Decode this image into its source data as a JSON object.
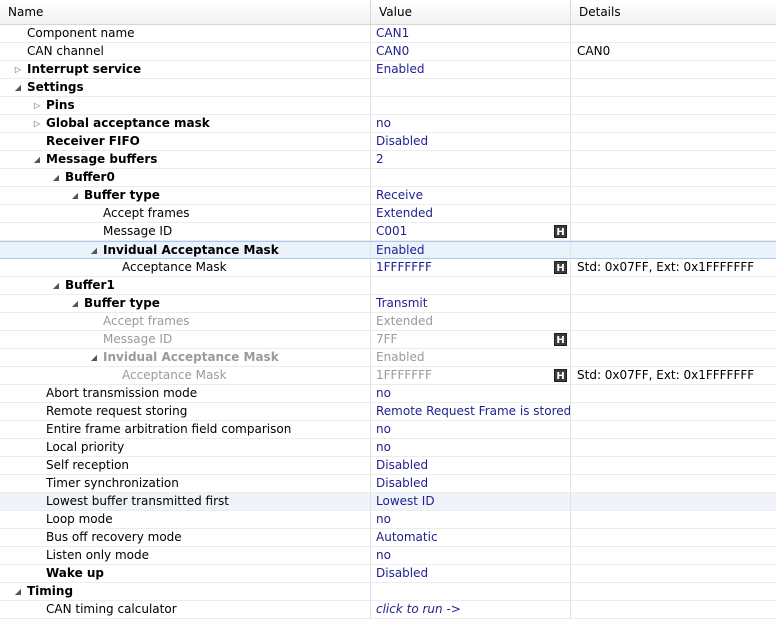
{
  "header": {
    "name": "Name",
    "value": "Value",
    "details": "Details"
  },
  "rows": [
    {
      "name": "Component name",
      "value": "CAN1",
      "details": ""
    },
    {
      "name": "CAN channel",
      "value": "CAN0",
      "details": "CAN0"
    },
    {
      "name": "Interrupt service",
      "value": "Enabled",
      "details": ""
    },
    {
      "name": "Settings",
      "value": "",
      "details": ""
    },
    {
      "name": "Pins",
      "value": "",
      "details": ""
    },
    {
      "name": "Global acceptance mask",
      "value": "no",
      "details": ""
    },
    {
      "name": "Receiver FIFO",
      "value": "Disabled",
      "details": ""
    },
    {
      "name": "Message buffers",
      "value": "2",
      "details": ""
    },
    {
      "name": "Buffer0",
      "value": "",
      "details": ""
    },
    {
      "name": "Buffer type",
      "value": "Receive",
      "details": ""
    },
    {
      "name": "Accept frames",
      "value": "Extended",
      "details": ""
    },
    {
      "name": "Message ID",
      "value": "C001",
      "details": "",
      "hbutton": "H"
    },
    {
      "name": "Invidual Acceptance Mask",
      "value": "Enabled",
      "details": ""
    },
    {
      "name": "Acceptance Mask",
      "value": "1FFFFFFF",
      "details": "Std: 0x07FF, Ext: 0x1FFFFFFF",
      "hbutton": "H"
    },
    {
      "name": "Buffer1",
      "value": "",
      "details": ""
    },
    {
      "name": "Buffer type",
      "value": "Transmit",
      "details": ""
    },
    {
      "name": "Accept frames",
      "value": "Extended",
      "details": ""
    },
    {
      "name": "Message ID",
      "value": "7FF",
      "details": "",
      "hbutton": "H"
    },
    {
      "name": "Invidual Acceptance Mask",
      "value": "Enabled",
      "details": ""
    },
    {
      "name": "Acceptance Mask",
      "value": "1FFFFFFF",
      "details": "Std: 0x07FF, Ext: 0x1FFFFFFF",
      "hbutton": "H"
    },
    {
      "name": "Abort transmission mode",
      "value": "no",
      "details": ""
    },
    {
      "name": "Remote request storing",
      "value": "Remote Request Frame is stored",
      "details": ""
    },
    {
      "name": "Entire frame arbitration field comparison",
      "value": "no",
      "details": ""
    },
    {
      "name": "Local priority",
      "value": "no",
      "details": ""
    },
    {
      "name": "Self reception",
      "value": "Disabled",
      "details": ""
    },
    {
      "name": "Timer synchronization",
      "value": "Disabled",
      "details": ""
    },
    {
      "name": "Lowest buffer transmitted first",
      "value": "Lowest ID",
      "details": ""
    },
    {
      "name": "Loop mode",
      "value": "no",
      "details": ""
    },
    {
      "name": "Bus off recovery mode",
      "value": "Automatic",
      "details": ""
    },
    {
      "name": "Listen only mode",
      "value": "no",
      "details": ""
    },
    {
      "name": "Wake up",
      "value": "Disabled",
      "details": ""
    },
    {
      "name": "Timing",
      "value": "",
      "details": ""
    },
    {
      "name": "CAN timing calculator",
      "value": "click to run ->",
      "details": ""
    }
  ]
}
